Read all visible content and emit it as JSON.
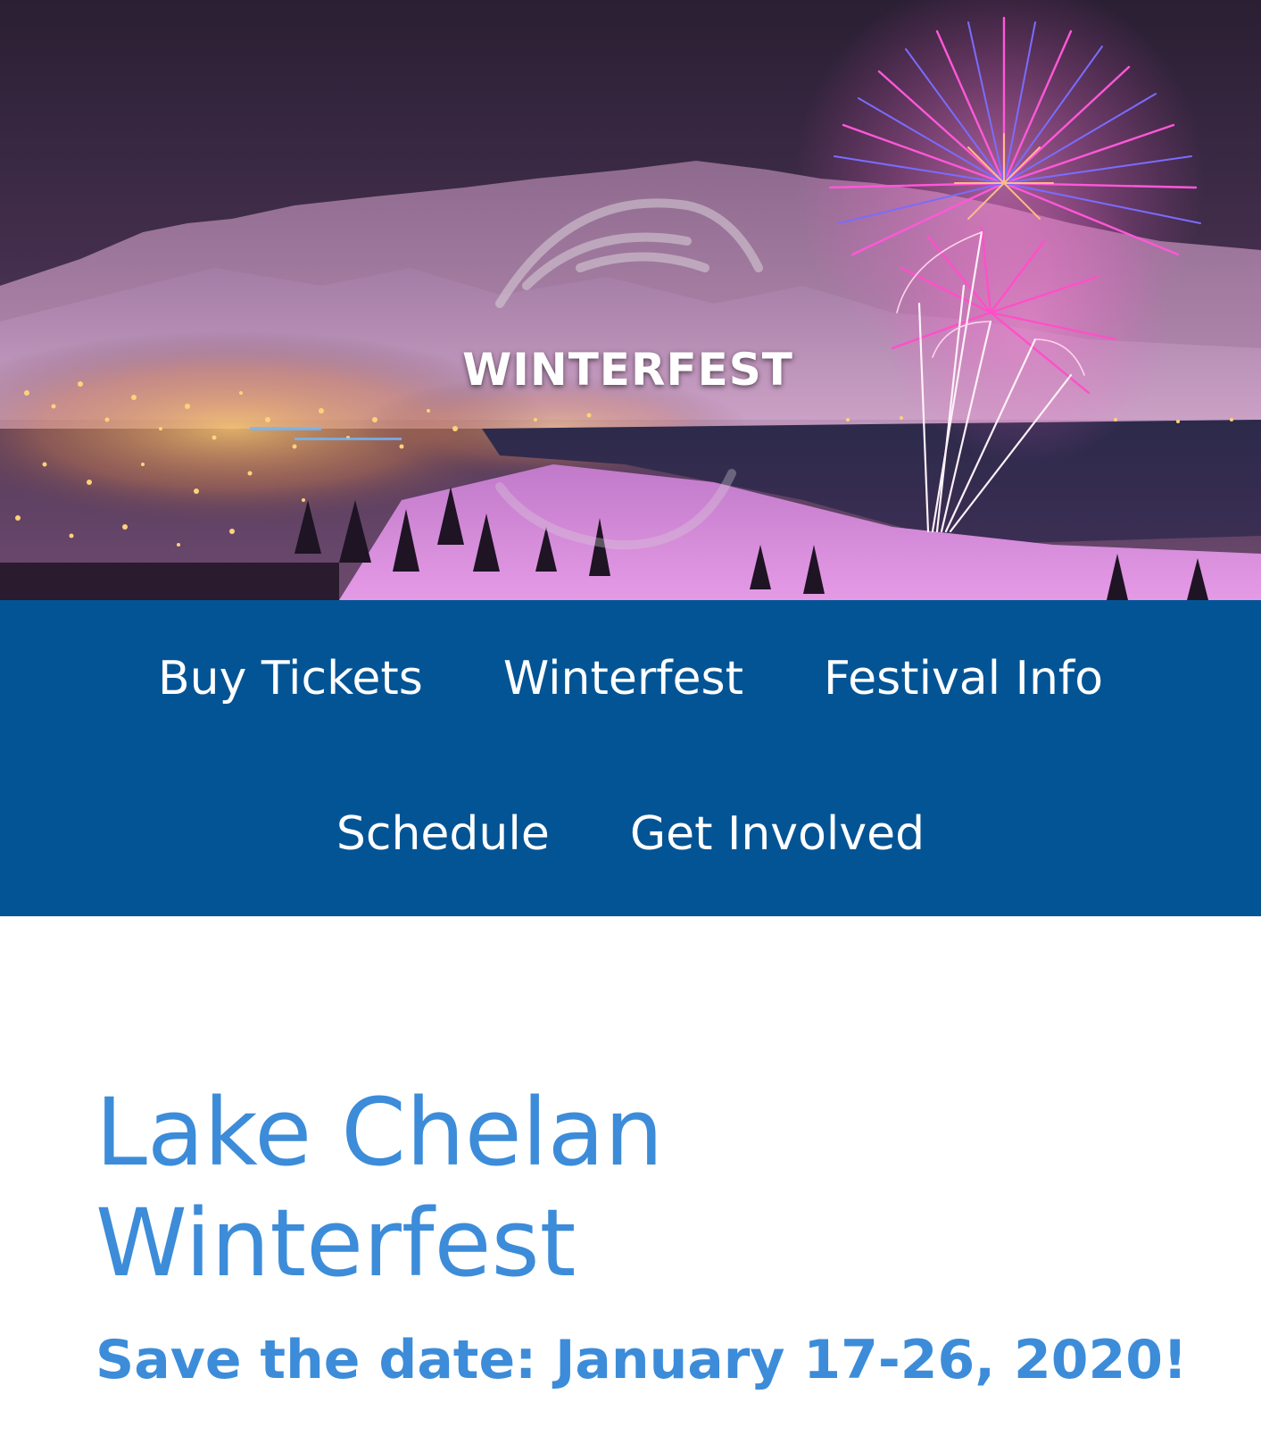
{
  "hero": {
    "logo_text": "WINTERFEST",
    "image_description_icon": "fireworks-over-lake-town-image"
  },
  "nav": {
    "items": [
      {
        "label": "Buy Tickets"
      },
      {
        "label": "Winterfest"
      },
      {
        "label": "Festival Info"
      },
      {
        "label": "Schedule"
      },
      {
        "label": "Get Involved"
      }
    ],
    "background_color": "#035495"
  },
  "main": {
    "title_line1": "Lake Chelan",
    "title_line2": "Winterfest",
    "tagline": "Save the date: January 17-26, 2020!",
    "accent_color": "#3c8cd9"
  }
}
